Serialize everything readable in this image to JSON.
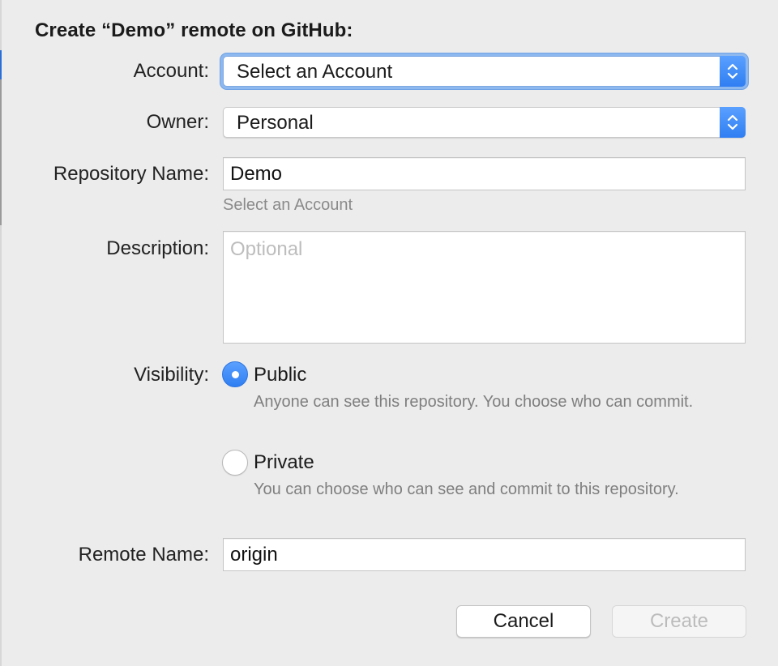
{
  "dialog": {
    "title": "Create “Demo” remote on GitHub:"
  },
  "fields": {
    "account": {
      "label": "Account:",
      "value": "Select an Account"
    },
    "owner": {
      "label": "Owner:",
      "value": "Personal"
    },
    "repository_name": {
      "label": "Repository Name:",
      "value": "Demo",
      "hint": "Select an Account"
    },
    "description": {
      "label": "Description:",
      "value": "",
      "placeholder": "Optional"
    },
    "visibility": {
      "label": "Visibility:",
      "selected": "Public",
      "options": [
        {
          "label": "Public",
          "description": "Anyone can see this repository. You choose who can commit."
        },
        {
          "label": "Private",
          "description": "You can choose who can see and commit to this repository."
        }
      ]
    },
    "remote_name": {
      "label": "Remote Name:",
      "value": "origin"
    }
  },
  "buttons": {
    "cancel": "Cancel",
    "create": "Create"
  },
  "icons": {
    "popup_stepper": "chevron-up-down-icon"
  },
  "colors": {
    "accent": "#2f7ef2",
    "background": "#ececec"
  }
}
